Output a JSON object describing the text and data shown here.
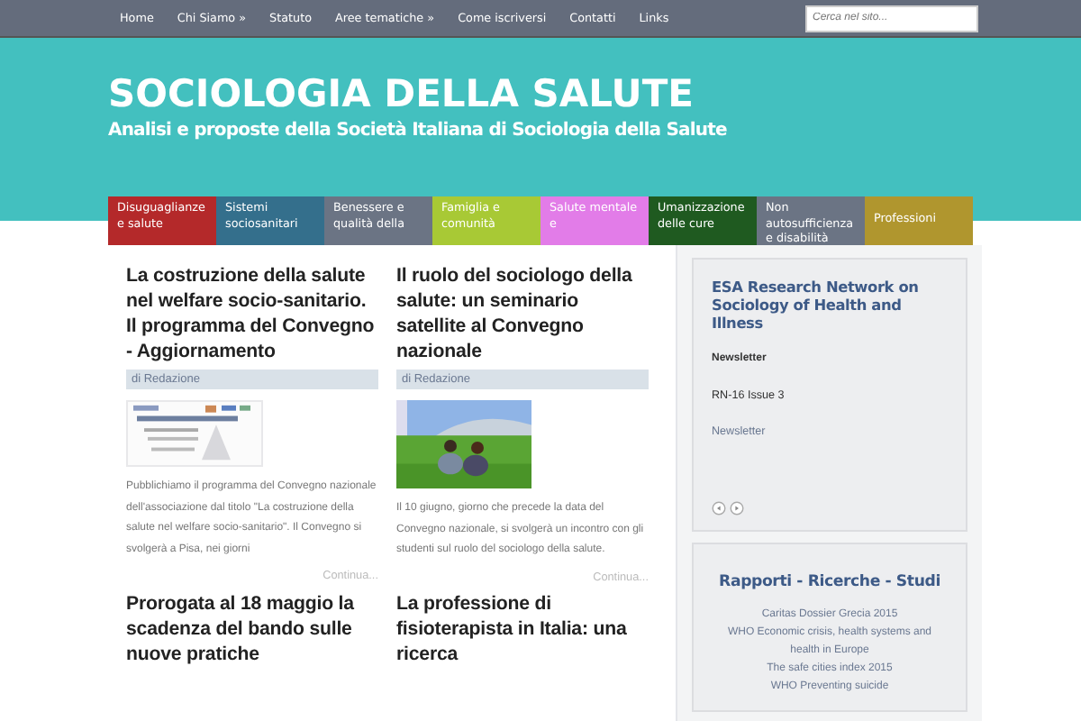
{
  "nav": {
    "items": [
      {
        "label": "Home",
        "dropdown": false
      },
      {
        "label": "Chi Siamo",
        "dropdown": true
      },
      {
        "label": "Statuto",
        "dropdown": false
      },
      {
        "label": "Aree tematiche",
        "dropdown": true
      },
      {
        "label": "Come iscriversi",
        "dropdown": false
      },
      {
        "label": "Contatti",
        "dropdown": false
      },
      {
        "label": "Links",
        "dropdown": false
      }
    ],
    "dropdown_mark": "»",
    "search": {
      "placeholder": "Cerca nel sito..."
    }
  },
  "header": {
    "title": "SOCIOLOGIA DELLA SALUTE",
    "subtitle": "Analisi e proposte della Società Italiana di Sociologia della Salute"
  },
  "categories": [
    {
      "label": "Disuguaglianze e salute",
      "color": "#b4292a"
    },
    {
      "label": "Sistemi sociosanitari",
      "color": "#346f8c"
    },
    {
      "label": "Benessere e qualità della",
      "color": "#6b7484"
    },
    {
      "label": "Famiglia e comunità",
      "color": "#a8c935"
    },
    {
      "label": "Salute mentale e",
      "color": "#e27ce8"
    },
    {
      "label": "Umanizzazione delle cure",
      "color": "#1f5a20"
    },
    {
      "label": "Non autosufficienza e disabilità",
      "color": "#6b7484"
    },
    {
      "label": "Professioni",
      "color": "#b0962e"
    }
  ],
  "posts": [
    {
      "title": "La costruzione della salute nel welfare socio-sanitario. Il programma del Convegno - Aggiornamento",
      "author": "di Redazione",
      "kind": "document",
      "excerpt": "Pubblichiamo il programma del Convegno nazionale dell'associazione dal titolo \"La costruzione della salute nel welfare socio-sanitario\". Il Convegno si svolgerà a Pisa, nei giorni",
      "more": "Continua..."
    },
    {
      "title": "Il ruolo del sociologo della salute: un seminario satellite al Convegno nazionale",
      "author": "di Redazione",
      "excerpt": "Il 10 giugno, giorno che precede la data del Convegno nazionale, si svolgerà un incontro con gli studenti sul ruolo del sociologo della salute.",
      "more": "Continua..."
    },
    {
      "title": "Prorogata al 18 maggio la scadenza del bando sulle nuove pratiche",
      "kind": "none"
    },
    {
      "title": "La professione di fisioterapista in Italia: una ricerca",
      "kind": "none"
    }
  ],
  "sidebar": {
    "esa": {
      "title": "ESA Research Network on Sociology of Health and Illness",
      "heading": "Newsletter",
      "issue": "RN-16 Issue 3",
      "link": "Newsletter"
    },
    "reports": {
      "title": "Rapporti - Ricerche - Studi",
      "links": [
        "Caritas Dossier Grecia 2015",
        "WHO Economic crisis, health systems and health in Europe",
        "The safe cities index 2015",
        "WHO Preventing suicide"
      ]
    }
  }
}
